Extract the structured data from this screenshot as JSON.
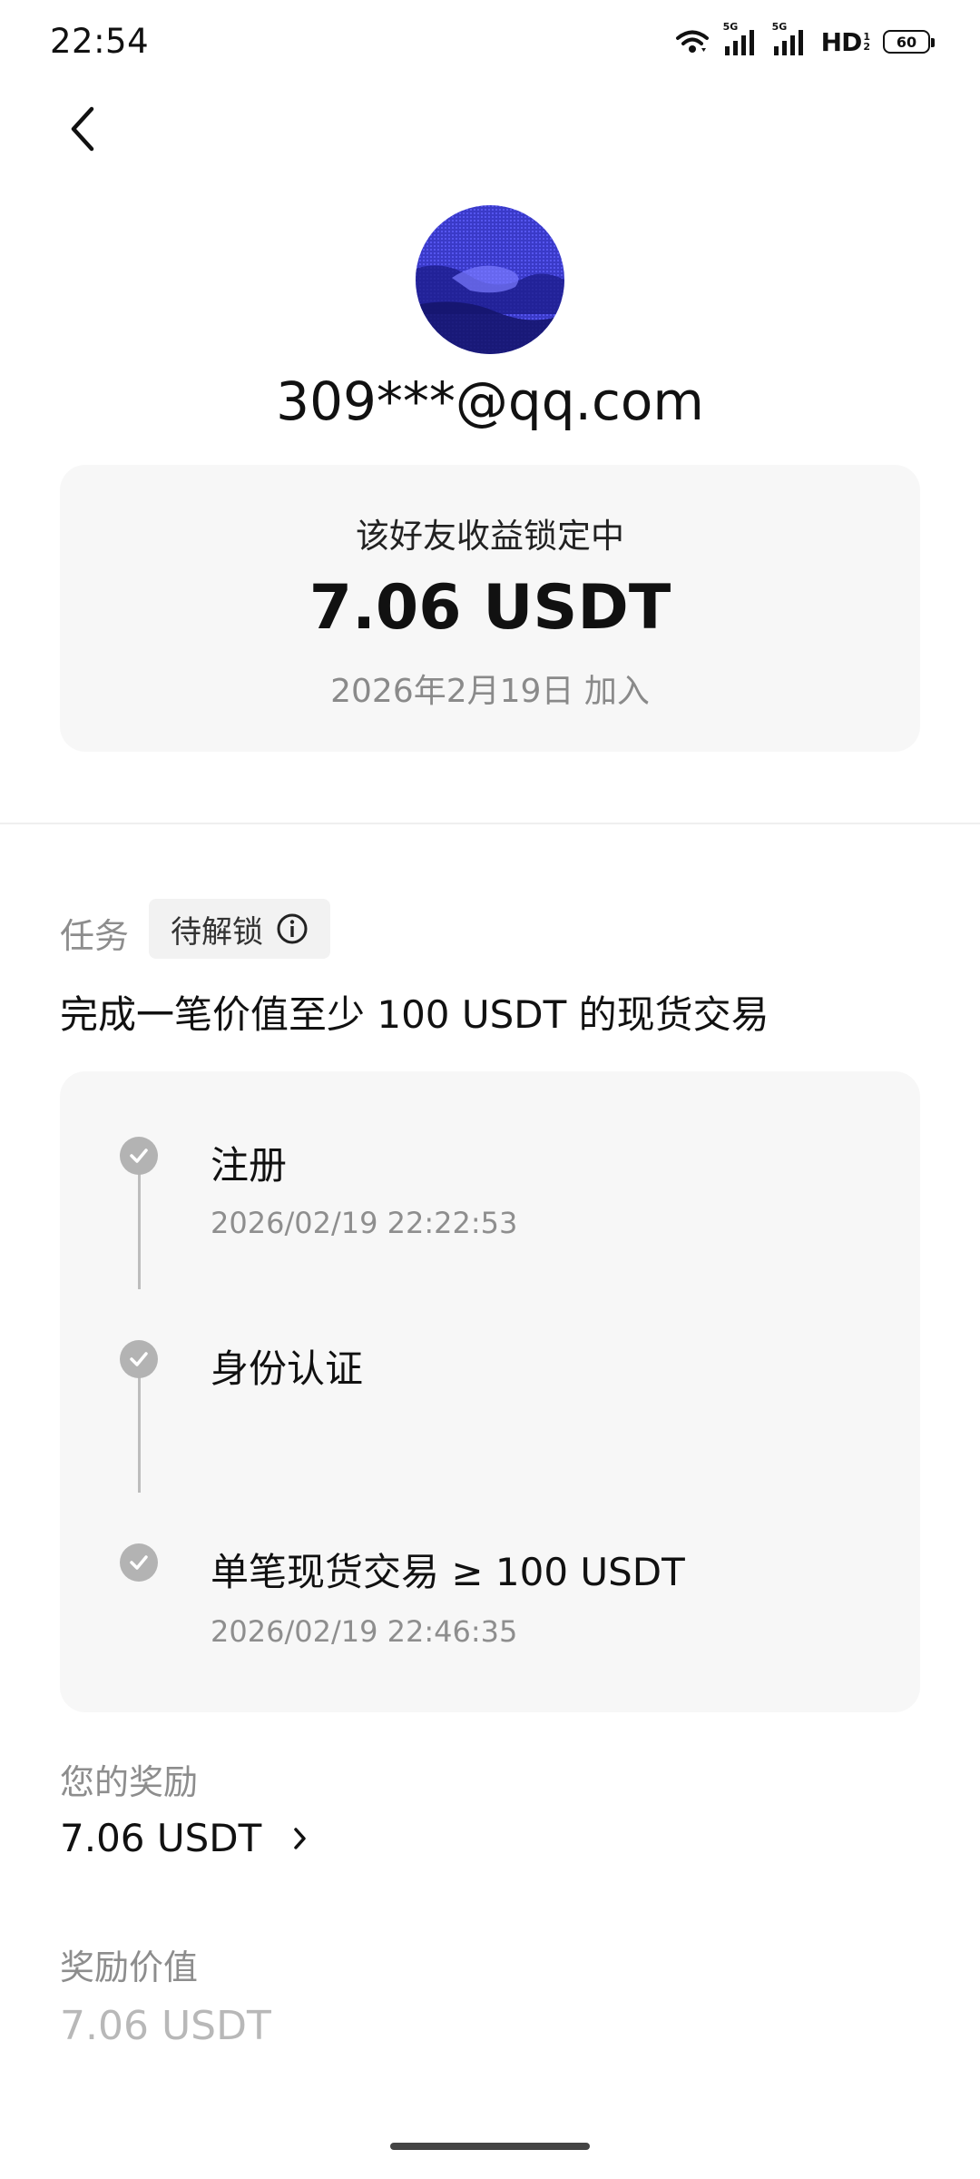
{
  "status_bar": {
    "time": "22:54",
    "network_1": "5G",
    "network_2": "5G",
    "hd": "HD",
    "hd_sup": "1",
    "hd_sub": "2",
    "battery": "60"
  },
  "profile": {
    "email": "309***@qq.com"
  },
  "summary": {
    "caption": "该好友收益锁定中",
    "amount": "7.06 USDT",
    "joined": "2026年2月19日 加入"
  },
  "task": {
    "label": "任务",
    "badge": "待解锁",
    "title": "完成一笔价值至少 100 USDT 的现货交易"
  },
  "steps": [
    {
      "title": "注册",
      "time": "2026/02/19 22:22:53",
      "done": true
    },
    {
      "title": "身份认证",
      "time": "",
      "done": true
    },
    {
      "title": "单笔现货交易 ≥ 100 USDT",
      "time": "2026/02/19 22:46:35",
      "done": true
    }
  ],
  "reward": {
    "label": "您的奖励",
    "value": "7.06 USDT"
  },
  "reward_value": {
    "label": "奖励价值",
    "value": "7.06 USDT"
  },
  "colors": {
    "check": "#b3b3b3",
    "card_bg": "#f7f7f7",
    "muted_text": "#8d8d8d"
  },
  "icons": [
    "wifi-icon",
    "signal-icon",
    "battery-icon",
    "back-arrow-icon",
    "info-icon",
    "check-icon",
    "chevron-right-icon"
  ]
}
